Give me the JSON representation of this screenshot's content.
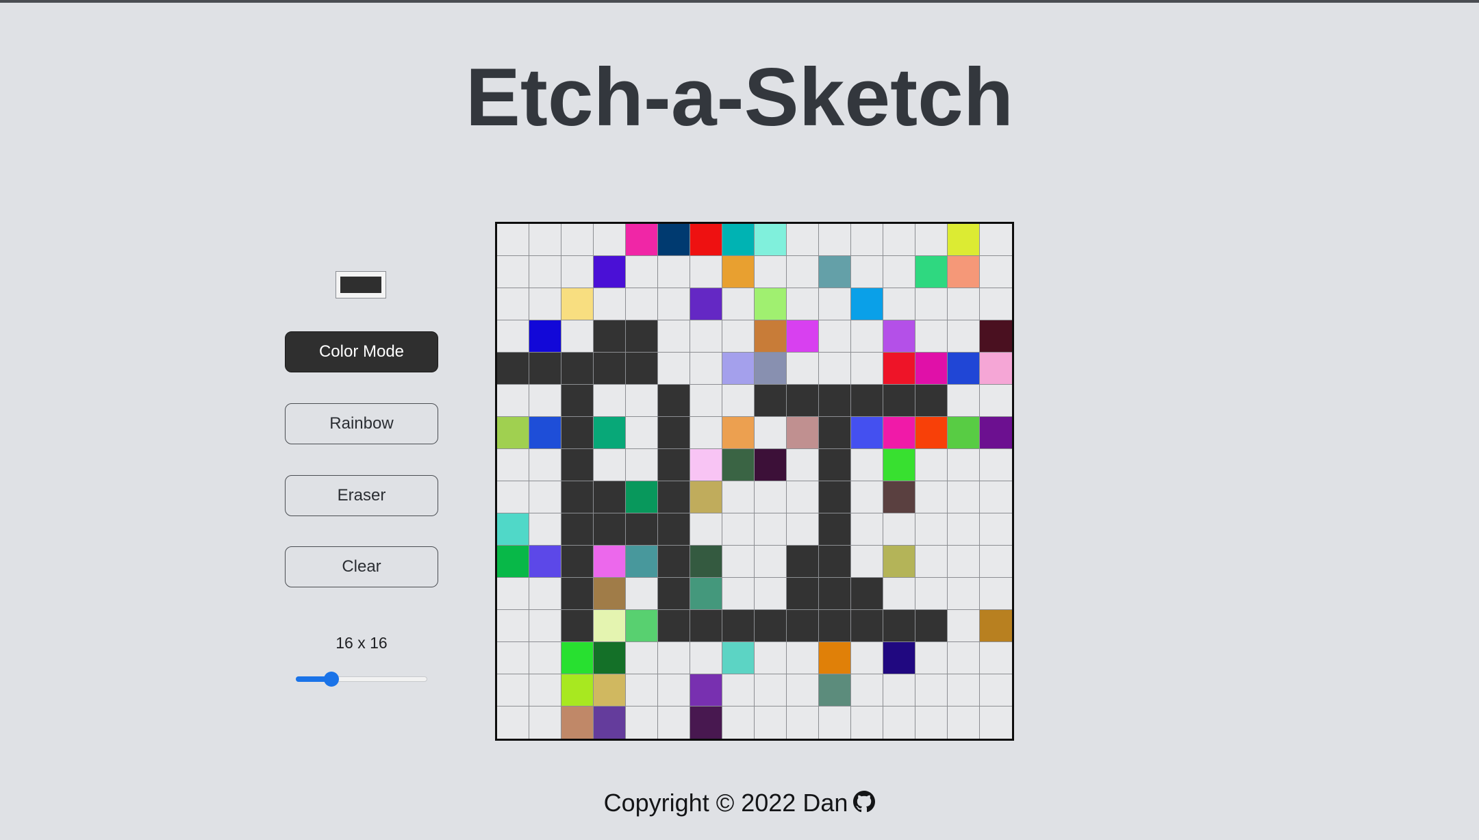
{
  "page": {
    "title": "Etch-a-Sketch"
  },
  "controls": {
    "current_color": "#2f2f2f",
    "buttons": {
      "color_mode": "Color Mode",
      "rainbow": "Rainbow",
      "eraser": "Eraser",
      "clear": "Clear"
    },
    "active_mode": "color_mode",
    "grid_size_label": "16 x 16",
    "grid_size": 16,
    "slider_min": 1,
    "slider_max": 64,
    "slider_fraction": 0.27
  },
  "board": {
    "size": 16,
    "empty_color": "#e8e9eb",
    "ink_color": "#333333",
    "cells": [
      [
        "#e8e9eb",
        "#e8e9eb",
        "#e8e9eb",
        "#e8e9eb",
        "#f026a6",
        "#003a70",
        "#ee1111",
        "#00b3b3",
        "#80f0dc",
        "#e8e9eb",
        "#e8e9eb",
        "#e8e9eb",
        "#e8e9eb",
        "#e8e9eb",
        "#dceb33",
        "#e8e9eb"
      ],
      [
        "#e8e9eb",
        "#e8e9eb",
        "#e8e9eb",
        "#4a10d6",
        "#e8e9eb",
        "#e8e9eb",
        "#e8e9eb",
        "#e8a030",
        "#e8e9eb",
        "#e8e9eb",
        "#64a0a8",
        "#e8e9eb",
        "#e8e9eb",
        "#2fd880",
        "#f59878",
        "#e8e9eb"
      ],
      [
        "#e8e9eb",
        "#e8e9eb",
        "#f8de80",
        "#e8e9eb",
        "#e8e9eb",
        "#e8e9eb",
        "#6428c4",
        "#e8e9eb",
        "#a0f070",
        "#e8e9eb",
        "#e8e9eb",
        "#0aa0e8",
        "#e8e9eb",
        "#e8e9eb",
        "#e8e9eb",
        "#e8e9eb"
      ],
      [
        "#e8e9eb",
        "#1208d8",
        "#e8e9eb",
        "#333333",
        "#333333",
        "#e8e9eb",
        "#e8e9eb",
        "#e8e9eb",
        "#c87c38",
        "#d840f0",
        "#e8e9eb",
        "#e8e9eb",
        "#b450e8",
        "#e8e9eb",
        "#e8e9eb",
        "#4a1020"
      ],
      [
        "#333333",
        "#333333",
        "#333333",
        "#333333",
        "#333333",
        "#e8e9eb",
        "#e8e9eb",
        "#a4a0ec",
        "#8890b0",
        "#e8e9eb",
        "#e8e9eb",
        "#e8e9eb",
        "#ee1428",
        "#e010a8",
        "#2046d6",
        "#f5a6d6"
      ],
      [
        "#e8e9eb",
        "#e8e9eb",
        "#333333",
        "#e8e9eb",
        "#e8e9eb",
        "#333333",
        "#e8e9eb",
        "#e8e9eb",
        "#333333",
        "#333333",
        "#333333",
        "#333333",
        "#333333",
        "#333333",
        "#e8e9eb",
        "#e8e9eb"
      ],
      [
        "#a0d050",
        "#1e4ed8",
        "#333333",
        "#08a878",
        "#e8e9eb",
        "#333333",
        "#e8e9eb",
        "#eca050",
        "#e8e9eb",
        "#c09090",
        "#333333",
        "#4450f0",
        "#f01aa8",
        "#f84008",
        "#58cc44",
        "#6c1090"
      ],
      [
        "#e8e9eb",
        "#e8e9eb",
        "#333333",
        "#e8e9eb",
        "#e8e9eb",
        "#333333",
        "#f8c4f4",
        "#3a6444",
        "#3c1038",
        "#e8e9eb",
        "#333333",
        "#e8e9eb",
        "#38e030",
        "#e8e9eb",
        "#e8e9eb",
        "#e8e9eb"
      ],
      [
        "#e8e9eb",
        "#e8e9eb",
        "#333333",
        "#333333",
        "#08985c",
        "#333333",
        "#c0ac5c",
        "#e8e9eb",
        "#e8e9eb",
        "#e8e9eb",
        "#333333",
        "#e8e9eb",
        "#5a4040",
        "#e8e9eb",
        "#e8e9eb",
        "#e8e9eb"
      ],
      [
        "#50d8c8",
        "#e8e9eb",
        "#333333",
        "#333333",
        "#333333",
        "#333333",
        "#e8e9eb",
        "#e8e9eb",
        "#e8e9eb",
        "#e8e9eb",
        "#333333",
        "#e8e9eb",
        "#e8e9eb",
        "#e8e9eb",
        "#e8e9eb",
        "#e8e9eb"
      ],
      [
        "#08b848",
        "#5c48e8",
        "#333333",
        "#ec68ec",
        "#48989c",
        "#333333",
        "#345a40",
        "#e8e9eb",
        "#e8e9eb",
        "#333333",
        "#333333",
        "#e8e9eb",
        "#b4b458",
        "#e8e9eb",
        "#e8e9eb",
        "#e8e9eb"
      ],
      [
        "#e8e9eb",
        "#e8e9eb",
        "#333333",
        "#a07c48",
        "#e8e9eb",
        "#333333",
        "#44987c",
        "#e8e9eb",
        "#e8e9eb",
        "#333333",
        "#333333",
        "#333333",
        "#e8e9eb",
        "#e8e9eb",
        "#e8e9eb",
        "#e8e9eb"
      ],
      [
        "#e8e9eb",
        "#e8e9eb",
        "#333333",
        "#e4f4b0",
        "#58d070",
        "#333333",
        "#333333",
        "#333333",
        "#333333",
        "#333333",
        "#333333",
        "#333333",
        "#333333",
        "#333333",
        "#e8e9eb",
        "#b88020"
      ],
      [
        "#e8e9eb",
        "#e8e9eb",
        "#28e030",
        "#147028",
        "#e8e9eb",
        "#e8e9eb",
        "#e8e9eb",
        "#5cd4c4",
        "#e8e9eb",
        "#e8e9eb",
        "#e08008",
        "#e8e9eb",
        "#200880",
        "#e8e9eb",
        "#e8e9eb",
        "#e8e9eb"
      ],
      [
        "#e8e9eb",
        "#e8e9eb",
        "#a8e820",
        "#d0b860",
        "#e8e9eb",
        "#e8e9eb",
        "#7830b0",
        "#e8e9eb",
        "#e8e9eb",
        "#e8e9eb",
        "#5c8c7c",
        "#e8e9eb",
        "#e8e9eb",
        "#e8e9eb",
        "#e8e9eb",
        "#e8e9eb"
      ],
      [
        "#e8e9eb",
        "#e8e9eb",
        "#c08868",
        "#643c9c",
        "#e8e9eb",
        "#e8e9eb",
        "#481850",
        "#e8e9eb",
        "#e8e9eb",
        "#e8e9eb",
        "#e8e9eb",
        "#e8e9eb",
        "#e8e9eb",
        "#e8e9eb",
        "#e8e9eb",
        "#e8e9eb"
      ]
    ]
  },
  "footer": {
    "copyright": "Copyright © 2022 Dan",
    "icon": "github-icon"
  }
}
